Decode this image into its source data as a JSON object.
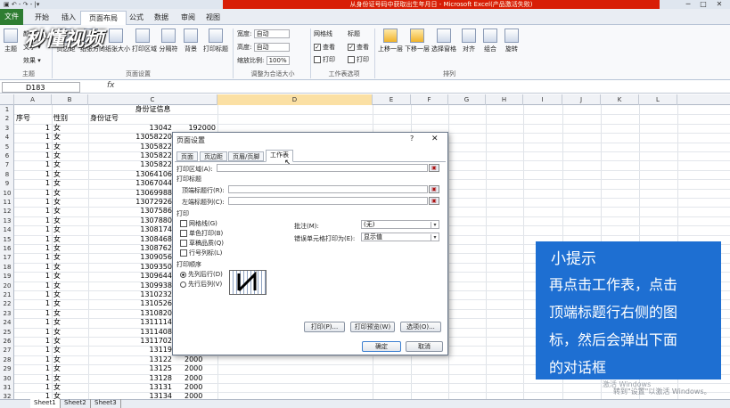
{
  "window": {
    "title": "从身份证号码中获取出生年月日 - Microsoft Excel(产品激活失败)",
    "qat": "▣ ↶ - ↷ - |▾",
    "min": "─",
    "max": "□",
    "close": "✕"
  },
  "tabs": [
    {
      "label": "文件"
    },
    {
      "label": "开始"
    },
    {
      "label": "插入"
    },
    {
      "label": "页面布局"
    },
    {
      "label": "公式"
    },
    {
      "label": "数据"
    },
    {
      "label": "审阅"
    },
    {
      "label": "视图"
    }
  ],
  "ribbon": {
    "theme": {
      "big": "主题",
      "color": "颜色 ▾",
      "font": "文字 ▾",
      "effect": "效果 ▾",
      "group": "主题"
    },
    "page_setup": {
      "buttons": [
        "页边距",
        "纸张方向",
        "纸张大小",
        "打印区域",
        "分隔符",
        "背景",
        "打印标题"
      ],
      "group": "页面设置"
    },
    "scale": {
      "width_label": "宽度:",
      "width_val": "自动",
      "height_label": "高度:",
      "height_val": "自动",
      "scale_label": "缩放比例:",
      "scale_val": "100%",
      "group": "调整为合适大小"
    },
    "sheet_options": {
      "gridlines": "网格线",
      "headings": "标题",
      "view": "查看",
      "print": "打印",
      "group": "工作表选项"
    },
    "arrange": {
      "buttons": [
        "上移一层",
        "下移一层",
        "选择窗格",
        "对齐",
        "组合",
        "旋转"
      ],
      "group": "排列"
    }
  },
  "formula": {
    "namebox": "D183",
    "fx": "fx",
    "value": ""
  },
  "columns": [
    "A",
    "B",
    "C",
    "D",
    "E",
    "F",
    "G",
    "H",
    "I",
    "J",
    "K",
    "L"
  ],
  "rows": [
    "1",
    "2",
    "3",
    "4",
    "5",
    "6",
    "7",
    "8",
    "9",
    "10",
    "11",
    "12",
    "13",
    "14",
    "15",
    "16",
    "17",
    "18",
    "19",
    "20",
    "21",
    "22",
    "23",
    "24",
    "25",
    "26",
    "27",
    "28",
    "29",
    "30",
    "31",
    "32"
  ],
  "cells": {
    "r1c": "身份证信息",
    "r2a": "序号",
    "r2b": "性别",
    "r2c": "身份证号",
    "col_a": [
      "1",
      "1",
      "1",
      "1",
      "1",
      "1",
      "1",
      "1",
      "1",
      "1",
      "1",
      "1",
      "1",
      "1",
      "1",
      "1",
      "1",
      "1",
      "1",
      "1",
      "1",
      "1",
      "1",
      "1",
      "1",
      "1",
      "1",
      "1",
      "1",
      "1"
    ],
    "col_b": [
      "女",
      "女",
      "女",
      "女",
      "女",
      "女",
      "女",
      "女",
      "女",
      "女",
      "女",
      "女",
      "女",
      "女",
      "女",
      "女",
      "女",
      "女",
      "女",
      "女",
      "女",
      "女",
      "女",
      "女",
      "女",
      "女",
      "女",
      "女",
      "女",
      "女"
    ],
    "col_c": [
      "13042",
      "13058220",
      "1305822",
      "1305822",
      "1305822",
      "13064106",
      "13067044",
      "13069988",
      "13072926",
      "1307586",
      "1307880",
      "1308174",
      "1308468",
      "1308762",
      "1309056",
      "1309350",
      "1309644",
      "1309938",
      "1310232",
      "1310526",
      "1310820",
      "1311114",
      "1311408",
      "1311702",
      "13119",
      "13122",
      "13125",
      "13128",
      "13131",
      "13134"
    ],
    "c3tail": "192000",
    "c_tail": [
      "2000",
      "2000",
      "2000",
      "2000",
      "2000",
      "2000",
      "2000"
    ]
  },
  "sheet_tabs": [
    "Sheet1",
    "Sheet2",
    "Sheet3"
  ],
  "dialog": {
    "title": "页面设置",
    "help": "?",
    "close": "✕",
    "tabs": [
      "页面",
      "页边距",
      "页眉/页脚",
      "工作表"
    ],
    "print_area_label": "打印区域(A):",
    "print_titles": "打印标题",
    "top_rows_label": "顶端标题行(R):",
    "left_cols_label": "左端标题列(C):",
    "print_section": "打印",
    "gridlines": "网格线(G)",
    "mono": "单色打印(B)",
    "draft": "草稿品质(Q)",
    "rowcol": "行号列标(L)",
    "comments_label": "批注(M):",
    "comments_val": "(无)",
    "errors_label": "错误单元格打印为(E):",
    "errors_val": "显示值",
    "order_section": "打印顺序",
    "order1": "先列后行(D)",
    "order2": "先行后列(V)",
    "print_btn": "打印(P)...",
    "preview_btn": "打印预览(W)",
    "options_btn": "选项(O)...",
    "ok": "确定",
    "cancel": "取消"
  },
  "tip": {
    "title": "小提示",
    "lines": [
      "再点击工作表，点击",
      "顶端标题行右侧的图",
      "标，然后会弹出下面",
      "的对话框"
    ]
  },
  "watermark": {
    "logo": "秒懂视频",
    "line1": "激活 Windows",
    "line2": "转到\"设置\"以激活 Windows。"
  },
  "colors": {
    "accent": "#1e6fd2",
    "file_tab": "#2e7d32",
    "title_red": "#d81e06"
  }
}
